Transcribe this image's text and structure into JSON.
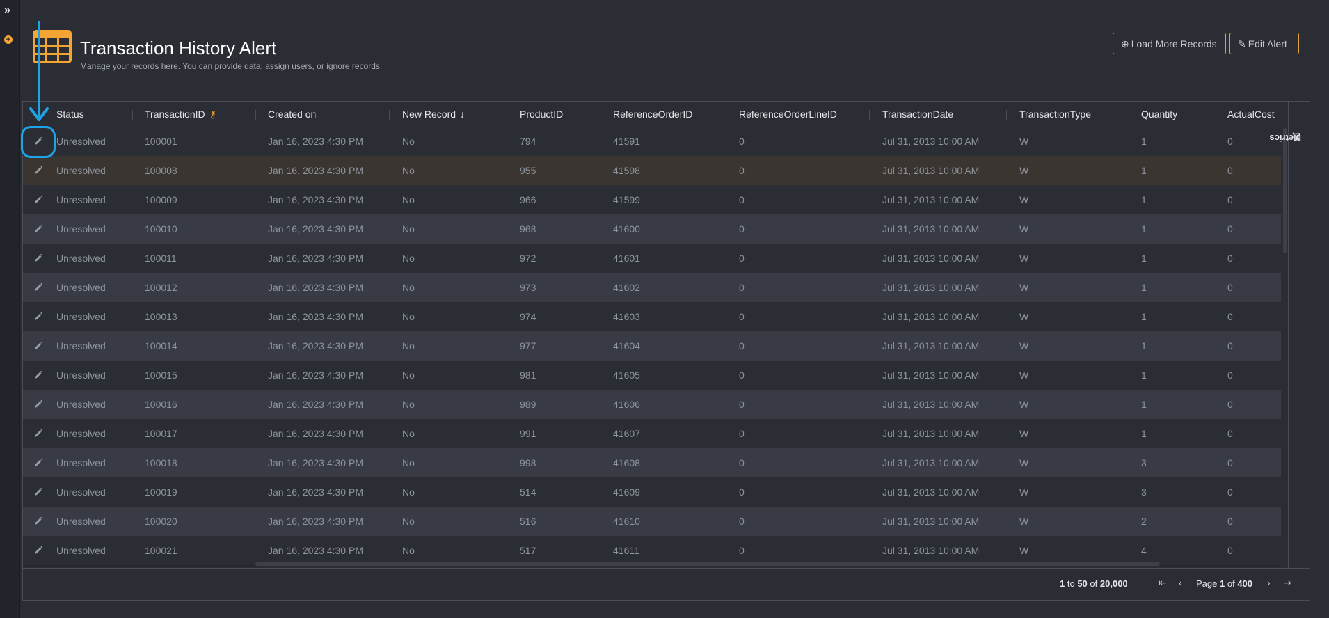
{
  "app": {
    "title": "Transaction History Alert",
    "subtitle": "Manage your records here. You can provide data, assign users, or ignore records.",
    "logo_icon": "table-grid-icon",
    "accent_color": "#f4a533",
    "annotation_color": "#1fa3e8"
  },
  "leftbar": {
    "expand_icon": "double-chevron-right-icon",
    "add_icon": "plus-circle-icon"
  },
  "buttons": {
    "load_more": {
      "label": "Load More Records",
      "icon": "arrow-circle-down-icon"
    },
    "edit_alert": {
      "label": "Edit Alert",
      "icon": "edit-square-icon"
    }
  },
  "columns": [
    {
      "key": "status",
      "label": "Status"
    },
    {
      "key": "transactionid",
      "label": "TransactionID",
      "icon": "key-icon"
    },
    {
      "key": "created",
      "label": "Created on"
    },
    {
      "key": "newrecord",
      "label": "New Record",
      "icon": "arrow-down-sort-icon"
    },
    {
      "key": "productid",
      "label": "ProductID"
    },
    {
      "key": "refid",
      "label": "ReferenceOrderID"
    },
    {
      "key": "reflineid",
      "label": "ReferenceOrderLineID"
    },
    {
      "key": "tdate",
      "label": "TransactionDate"
    },
    {
      "key": "ttype",
      "label": "TransactionType"
    },
    {
      "key": "qty",
      "label": "Quantity"
    },
    {
      "key": "cost",
      "label": "ActualCost"
    }
  ],
  "rows": [
    [
      "Unresolved",
      "100001",
      "Jan 16, 2023 4:30 PM",
      "No",
      "794",
      "41591",
      "0",
      "Jul 31, 2013 10:00 AM",
      "W",
      "1",
      "0"
    ],
    [
      "Unresolved",
      "100008",
      "Jan 16, 2023 4:30 PM",
      "No",
      "955",
      "41598",
      "0",
      "Jul 31, 2013 10:00 AM",
      "W",
      "1",
      "0"
    ],
    [
      "Unresolved",
      "100009",
      "Jan 16, 2023 4:30 PM",
      "No",
      "966",
      "41599",
      "0",
      "Jul 31, 2013 10:00 AM",
      "W",
      "1",
      "0"
    ],
    [
      "Unresolved",
      "100010",
      "Jan 16, 2023 4:30 PM",
      "No",
      "968",
      "41600",
      "0",
      "Jul 31, 2013 10:00 AM",
      "W",
      "1",
      "0"
    ],
    [
      "Unresolved",
      "100011",
      "Jan 16, 2023 4:30 PM",
      "No",
      "972",
      "41601",
      "0",
      "Jul 31, 2013 10:00 AM",
      "W",
      "1",
      "0"
    ],
    [
      "Unresolved",
      "100012",
      "Jan 16, 2023 4:30 PM",
      "No",
      "973",
      "41602",
      "0",
      "Jul 31, 2013 10:00 AM",
      "W",
      "1",
      "0"
    ],
    [
      "Unresolved",
      "100013",
      "Jan 16, 2023 4:30 PM",
      "No",
      "974",
      "41603",
      "0",
      "Jul 31, 2013 10:00 AM",
      "W",
      "1",
      "0"
    ],
    [
      "Unresolved",
      "100014",
      "Jan 16, 2023 4:30 PM",
      "No",
      "977",
      "41604",
      "0",
      "Jul 31, 2013 10:00 AM",
      "W",
      "1",
      "0"
    ],
    [
      "Unresolved",
      "100015",
      "Jan 16, 2023 4:30 PM",
      "No",
      "981",
      "41605",
      "0",
      "Jul 31, 2013 10:00 AM",
      "W",
      "1",
      "0"
    ],
    [
      "Unresolved",
      "100016",
      "Jan 16, 2023 4:30 PM",
      "No",
      "989",
      "41606",
      "0",
      "Jul 31, 2013 10:00 AM",
      "W",
      "1",
      "0"
    ],
    [
      "Unresolved",
      "100017",
      "Jan 16, 2023 4:30 PM",
      "No",
      "991",
      "41607",
      "0",
      "Jul 31, 2013 10:00 AM",
      "W",
      "1",
      "0"
    ],
    [
      "Unresolved",
      "100018",
      "Jan 16, 2023 4:30 PM",
      "No",
      "998",
      "41608",
      "0",
      "Jul 31, 2013 10:00 AM",
      "W",
      "3",
      "0"
    ],
    [
      "Unresolved",
      "100019",
      "Jan 16, 2023 4:30 PM",
      "No",
      "514",
      "41609",
      "0",
      "Jul 31, 2013 10:00 AM",
      "W",
      "3",
      "0"
    ],
    [
      "Unresolved",
      "100020",
      "Jan 16, 2023 4:30 PM",
      "No",
      "516",
      "41610",
      "0",
      "Jul 31, 2013 10:00 AM",
      "W",
      "2",
      "0"
    ],
    [
      "Unresolved",
      "100021",
      "Jan 16, 2023 4:30 PM",
      "No",
      "517",
      "41611",
      "0",
      "Jul 31, 2013 10:00 AM",
      "W",
      "4",
      "0"
    ]
  ],
  "highlighted_row_index": 1,
  "side_panel": {
    "label": "Metrics",
    "icon": "chart-line-icon"
  },
  "pagination": {
    "from": "1",
    "to_word": "to",
    "to": "50",
    "of_word": "of",
    "total": "20,000",
    "page_word": "Page",
    "page": "1",
    "page_of_word": "of",
    "pages": "400"
  }
}
